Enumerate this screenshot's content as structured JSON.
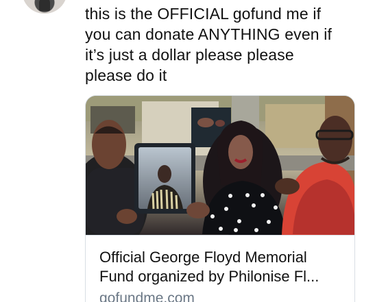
{
  "tweet": {
    "text": "this is the OFFICIAL gofund me if\nyou can donate ANYTHING even if\nit’s just a dollar please please\nplease do it",
    "avatar_icon": "profile-avatar-icon"
  },
  "link_card": {
    "image_icon": "memorial-photo",
    "title": "Official George Floyd Memorial Fund organized by Philonise Fl...",
    "domain": "gofundme.com"
  },
  "colors": {
    "text": "#111111",
    "secondary_text": "#6b7886",
    "border": "#d8dee4"
  }
}
